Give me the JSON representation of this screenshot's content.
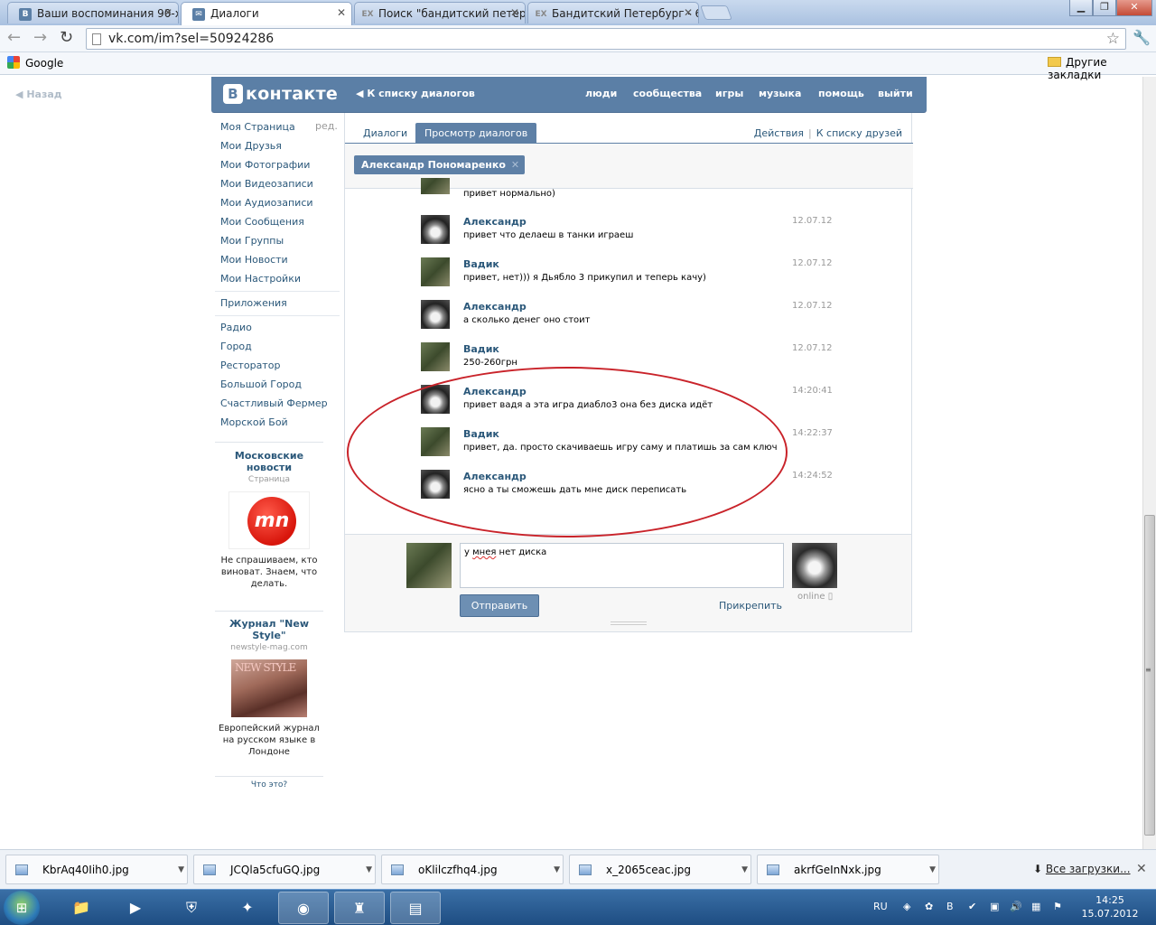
{
  "browser": {
    "tabs": [
      {
        "title": "Ваши воспоминания 90-х",
        "favicon": "В"
      },
      {
        "title": "Диалоги",
        "favicon": "✉"
      },
      {
        "title": "Поиск \"бандитский петер",
        "favicon": "EX"
      },
      {
        "title": "Бандитский Петербург - 6",
        "favicon": "EX"
      }
    ],
    "url": "vk.com/im?sel=50924286",
    "bookmarks": {
      "google": "Google",
      "other": "Другие закладки"
    }
  },
  "vk": {
    "back_label": "Назад",
    "logo": {
      "badge": "В",
      "text": "контакте"
    },
    "header_back": "К списку диалогов",
    "nav": [
      "люди",
      "сообщества",
      "игры",
      "музыка",
      "помощь",
      "выйти"
    ],
    "edit_label": "ред.",
    "menu_main": [
      "Моя Страница",
      "Мои Друзья",
      "Мои Фотографии",
      "Мои Видеозаписи",
      "Мои Аудиозаписи",
      "Мои Сообщения",
      "Мои Группы",
      "Мои Новости",
      "Мои Настройки"
    ],
    "menu_apps": [
      "Приложения"
    ],
    "menu_games": [
      "Радио",
      "Город",
      "Ресторатор",
      "Большой Город",
      "Счастливый Фермер",
      "Морской Бой"
    ],
    "ads": [
      {
        "title": "Московские новости",
        "subtitle": "Страница",
        "logo_text": "mn",
        "text": "Не спрашиваем, кто виноват. Знаем, что делать."
      },
      {
        "title": "Журнал \"New Style\"",
        "subtitle": "newstyle-mag.com",
        "logo_text": "NEW STYLE",
        "text": "Европейский журнал на русском языке в Лондоне"
      }
    ],
    "what_is_this": "Что это?",
    "tabs": [
      "Диалоги",
      "Просмотр диалогов"
    ],
    "actions": [
      "Действия",
      "К списку друзей"
    ],
    "peer_name": "Александр Пономаренко",
    "peer_close": "✕",
    "messages": [
      {
        "author": "",
        "text": "привет нормально)",
        "time": ""
      },
      {
        "author": "Александр",
        "text": "привет что делаеш в танки играеш",
        "time": "12.07.12"
      },
      {
        "author": "Вадик",
        "text": "привет, нет))) я Дьябло 3 прикупил и теперь качу)",
        "time": "12.07.12"
      },
      {
        "author": "Александр",
        "text": "а сколько денег оно стоит",
        "time": "12.07.12"
      },
      {
        "author": "Вадик",
        "text": "250-260грн",
        "time": "12.07.12"
      },
      {
        "author": "Александр",
        "text": "привет вадя а эта игра диабло3 она без диска идёт",
        "time": "14:20:41"
      },
      {
        "author": "Вадик",
        "text": "привет, да. просто скачиваешь игру саму и платишь за сам ключ",
        "time": "14:22:37"
      },
      {
        "author": "Александр",
        "text": "ясно а ты сможешь дать мне диск переписать",
        "time": "14:24:52"
      }
    ],
    "compose": {
      "text_a": "у ",
      "text_b": "мнея",
      "text_c": " нет диска",
      "send": "Отправить",
      "attach": "Прикрепить",
      "online": "online"
    }
  },
  "downloads": {
    "files": [
      "KbrAq40Iih0.jpg",
      "JCQla5cfuGQ.jpg",
      "oKlilczfhq4.jpg",
      "x_2065ceac.jpg",
      "akrfGeInNxk.jpg"
    ],
    "all": "Все загрузки..."
  },
  "taskbar": {
    "lang": "RU",
    "time": "14:25",
    "date": "15.07.2012"
  },
  "colors": {
    "vk_blue": "#5b7fa6",
    "link": "#2b587a",
    "annotation_red": "#c9232a"
  }
}
